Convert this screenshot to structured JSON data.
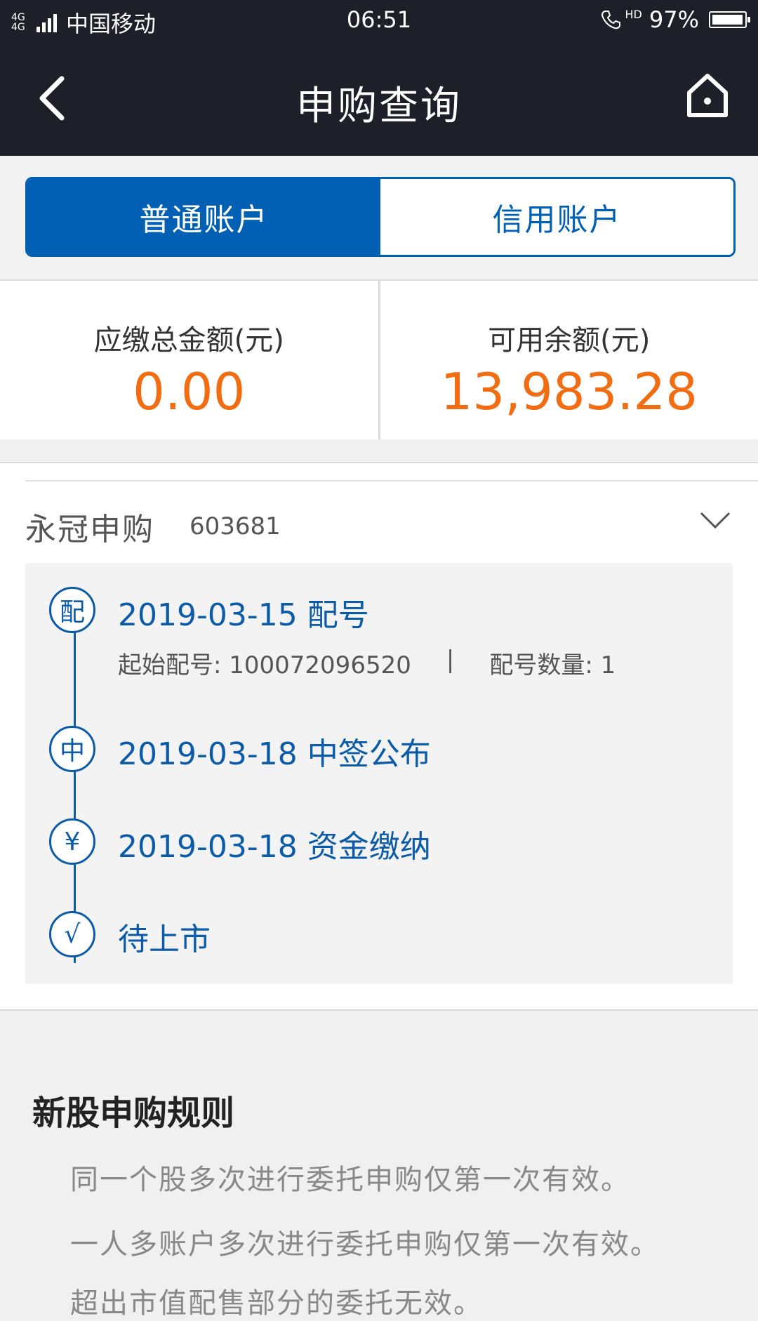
{
  "status_bar": {
    "network": "4G 4G",
    "carrier": "中国移动",
    "time": "06:51",
    "hd_label": "HD",
    "battery": "97%",
    "battery_level": 0.97
  },
  "nav": {
    "title": "申购查询",
    "icons": [
      "chevron-left-icon",
      "home-icon"
    ]
  },
  "tabs": [
    {
      "label": "普通账户",
      "active": true
    },
    {
      "label": "信用账户",
      "active": false
    }
  ],
  "summary": {
    "due_label": "应缴总金额(元)",
    "due_value": "0.00",
    "available_label": "可用余额(元)",
    "available_value": "13,983.28"
  },
  "stock": {
    "name": "永冠申购",
    "code": "603681",
    "timeline": [
      {
        "badge": "配",
        "text": "2019-03-15 配号",
        "detail": {
          "start_label": "起始配号: 100072096520",
          "separator": "|",
          "count_label": "配号数量: 1"
        }
      },
      {
        "badge": "中",
        "text": "2019-03-18 中签公布"
      },
      {
        "badge": "¥",
        "text": "2019-03-18 资金缴纳"
      },
      {
        "badge": "√",
        "text": "待上市"
      }
    ]
  },
  "rules": {
    "title": "新股申购规则",
    "items": [
      "同一个股多次进行委托申购仅第一次有效。",
      "一人多账户多次进行委托申购仅第一次有效。",
      "超出市值配售部分的委托无效。"
    ]
  },
  "colors": {
    "dark_header": "#1e2029",
    "primary_blue": "#0160b3",
    "amount_orange": "#f26c12"
  }
}
